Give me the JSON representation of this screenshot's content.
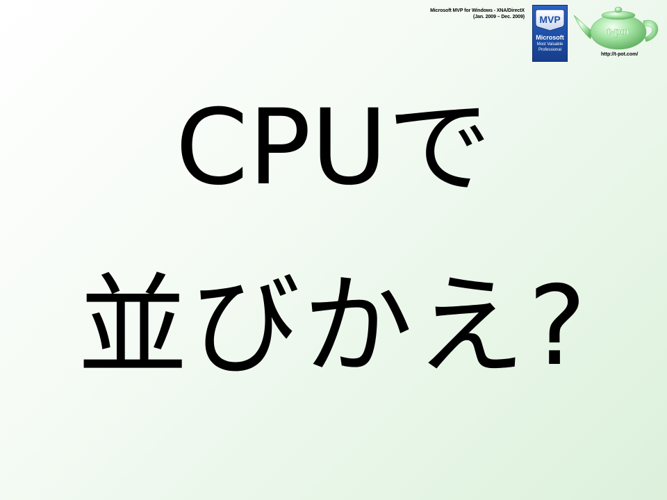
{
  "slide": {
    "credit_line1": "Microsoft MVP for Windows - XNA/DirectX",
    "credit_line2": "(Jan. 2009 – Dec. 2009)",
    "badge": {
      "mvp": "MVP",
      "microsoft": "Microsoft",
      "line1": "Most Valuable",
      "line2": "Professional"
    },
    "logo_text": "t-pot",
    "url": "http://t-pot.com/",
    "title_line1": "CPUで",
    "title_line2": "並びかえ?"
  },
  "colors": {
    "background_light": "#ffffff",
    "background_green": "#dcf0dc",
    "badge_blue": "#1d4ea6",
    "teapot_green": "#8fd88f"
  },
  "icons": [
    "mvp-badge",
    "teapot-logo"
  ]
}
